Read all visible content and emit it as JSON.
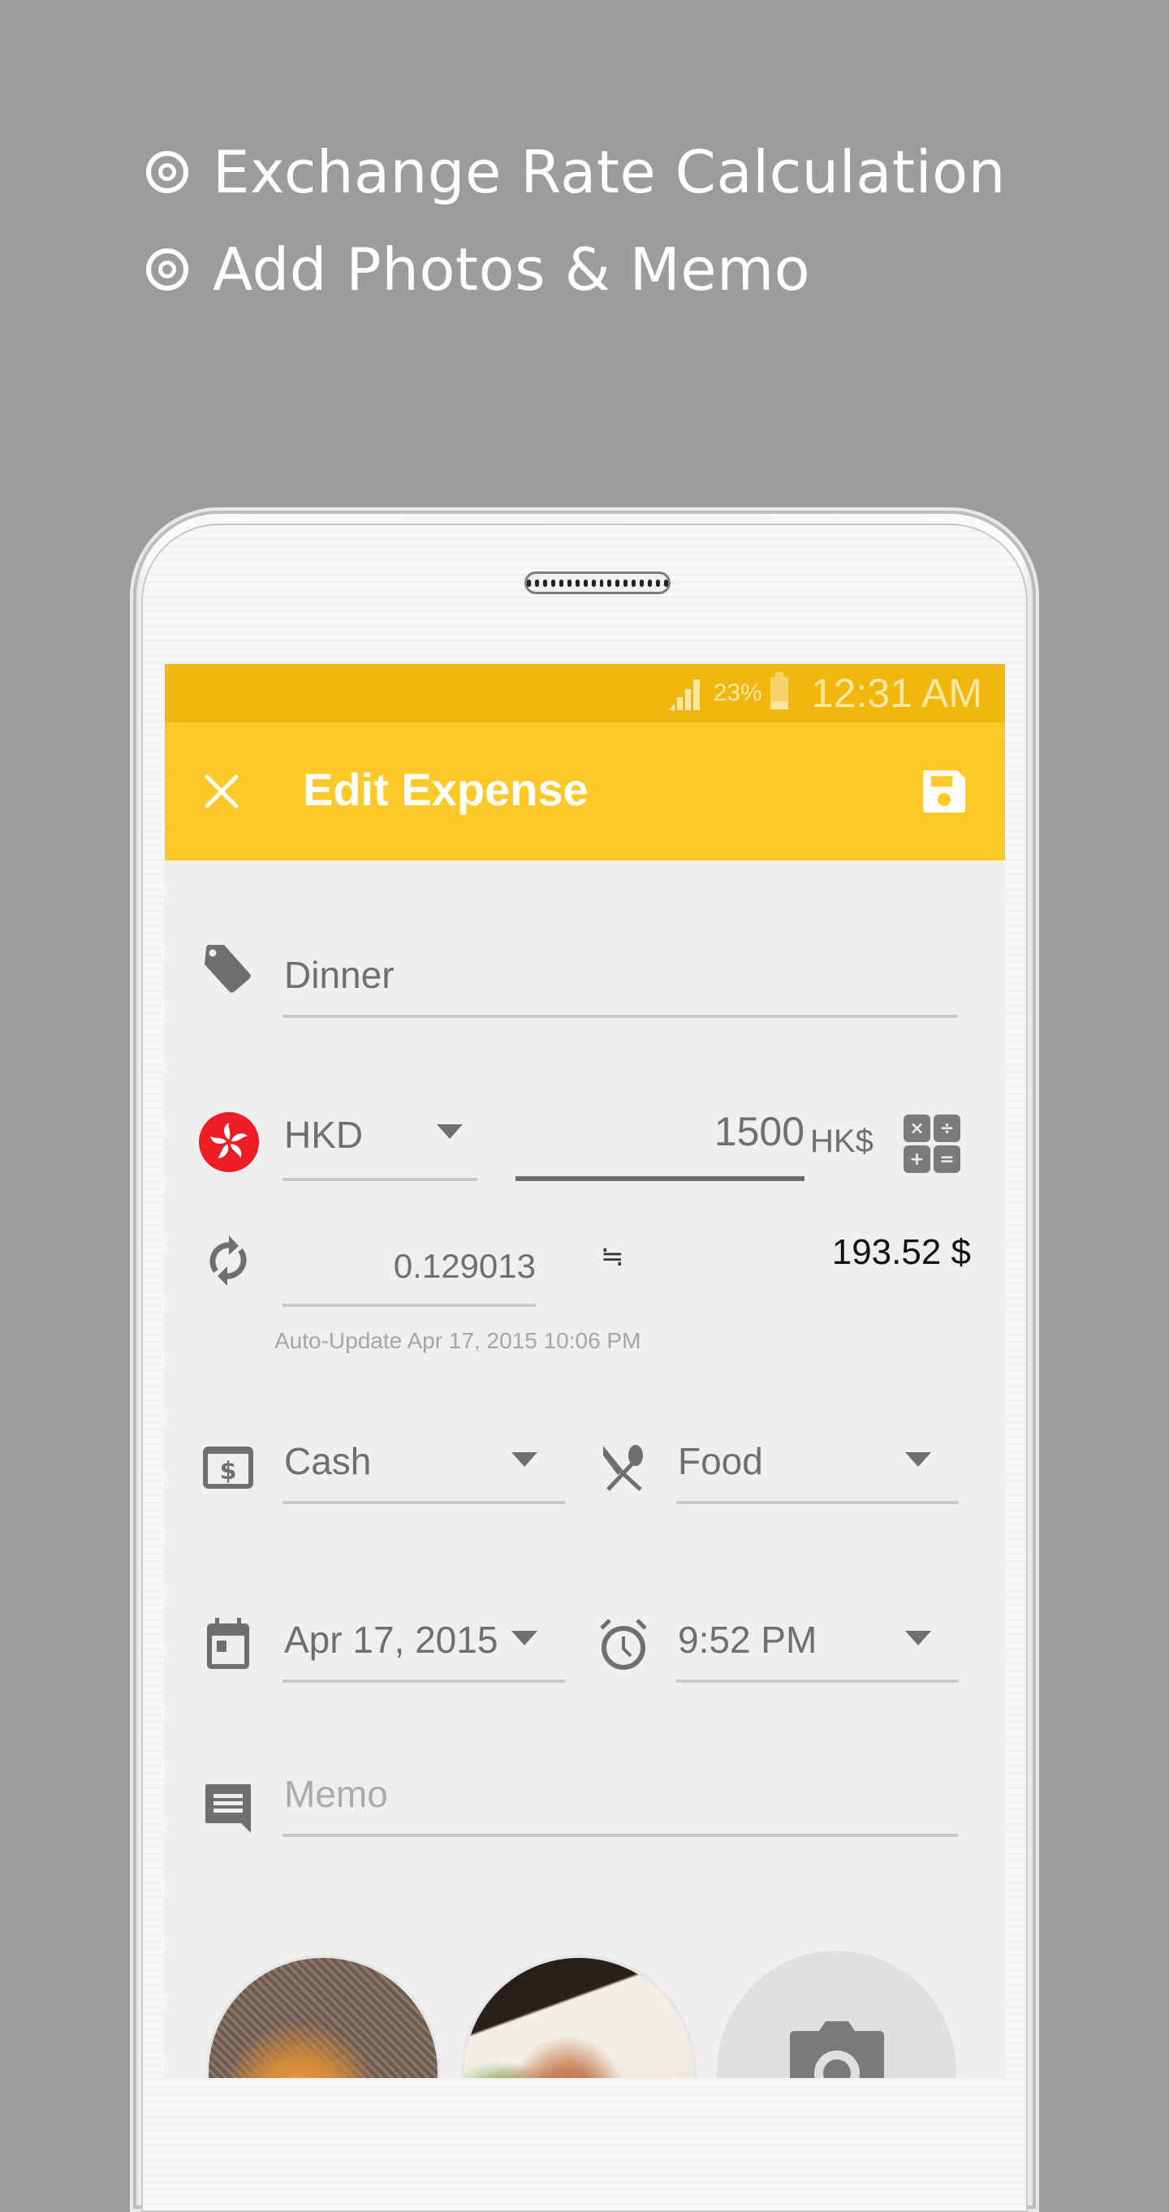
{
  "promo": {
    "lines": [
      "Exchange Rate Calculation",
      "Add Photos & Memo"
    ]
  },
  "status_bar": {
    "battery_percent": "23%",
    "time": "12:31 AM"
  },
  "toolbar": {
    "title": "Edit Expense",
    "close_icon": "close-icon",
    "save_icon": "save-floppy-icon"
  },
  "form": {
    "title_field": {
      "value": "Dinner",
      "icon": "tag-icon"
    },
    "currency": {
      "code": "HKD",
      "flag": "hong-kong-flag"
    },
    "amount": {
      "value": "1500",
      "unit": "HK$"
    },
    "rate": {
      "value": "0.129013",
      "approx_symbol": "≒",
      "converted": "193.52 $",
      "auto_update": "Auto-Update Apr 17, 2015 10:06 PM"
    },
    "payment": {
      "value": "Cash",
      "icon": "cash-icon"
    },
    "category": {
      "value": "Food",
      "icon": "fork-spoon-icon"
    },
    "date": {
      "value": "Apr 17, 2015",
      "icon": "calendar-icon"
    },
    "time": {
      "value": "9:52 PM",
      "icon": "alarm-clock-icon"
    },
    "memo": {
      "value": "",
      "placeholder": "Memo",
      "icon": "memo-icon"
    }
  },
  "photos": {
    "items": [
      "photo-salad",
      "photo-shrimp"
    ],
    "add_icon": "camera-icon"
  },
  "colors": {
    "status_bar": "#f2b70c",
    "toolbar": "#fdc928",
    "background": "#9c9c9c",
    "screen": "#efefef"
  }
}
